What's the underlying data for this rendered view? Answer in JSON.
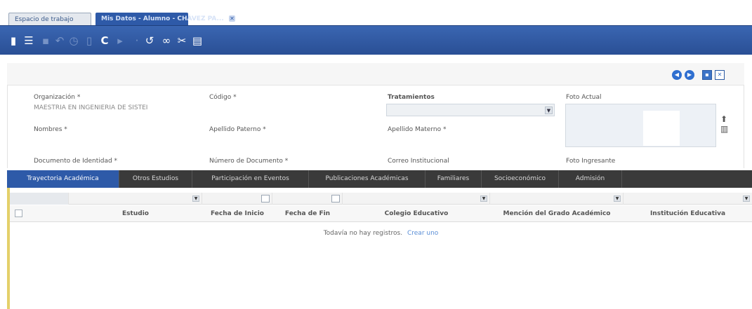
{
  "window_tabs": [
    {
      "label": "Espacio de trabajo",
      "active": false
    },
    {
      "label": "Mis Datos - Alumno - CHÁVEZ PA...",
      "active": true
    }
  ],
  "toolbar": {
    "icons": [
      "new-record-icon",
      "list-icon",
      "save-icon",
      "undo-icon",
      "history-icon",
      "delete-icon",
      "refresh-icon",
      "print-icon",
      "attach-icon",
      "help-icon",
      "link-icon",
      "tools-icon",
      "menu-icon"
    ]
  },
  "form": {
    "organizacion_label": "Organización *",
    "organizacion_value": "MAESTRIA EN INGENIERIA DE SISTEI",
    "codigo_label": "Código *",
    "tratamientos_label": "Tratamientos",
    "foto_actual_label": "Foto Actual",
    "nombres_label": "Nombres *",
    "apellido_paterno_label": "Apellido Paterno *",
    "apellido_materno_label": "Apellido Materno *",
    "documento_label": "Documento de Identidad *",
    "numero_documento_label": "Número de Documento *",
    "correo_label": "Correo Institucional",
    "foto_ingresante_label": "Foto Ingresante"
  },
  "section_tabs": [
    {
      "label": "Trayectoria Académica",
      "active": true
    },
    {
      "label": "Otros Estudios",
      "active": false
    },
    {
      "label": "Participación en Eventos",
      "active": false
    },
    {
      "label": "Publicaciones Académicas",
      "active": false
    },
    {
      "label": "Familiares",
      "active": false
    },
    {
      "label": "Socioeconómico",
      "active": false
    },
    {
      "label": "Admisión",
      "active": false
    }
  ],
  "grid": {
    "columns": [
      "Estudio",
      "Fecha de Inicio",
      "Fecha de Fin",
      "Colegio Educativo",
      "Mención del Grado Académico",
      "Institución Educativa"
    ],
    "empty_text": "Todavía no hay registros.",
    "create_link": "Crear uno"
  },
  "colors": {
    "toolbar_blue": "#2e5aa8",
    "tab_dark": "#3a3a3a",
    "accent_yellow": "#e4d06a"
  }
}
